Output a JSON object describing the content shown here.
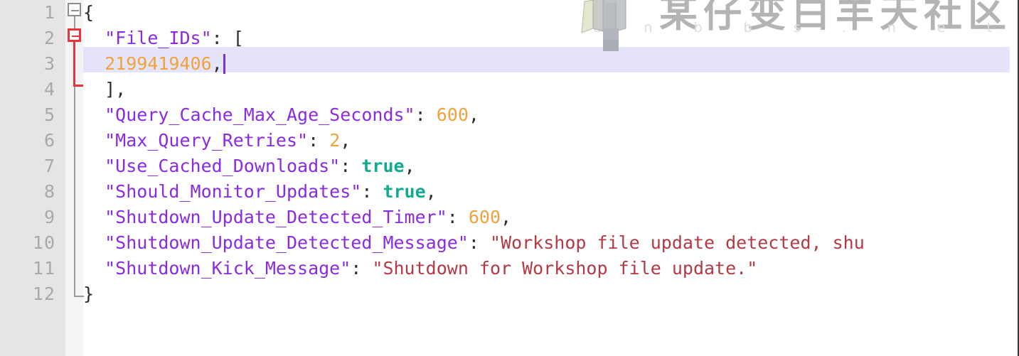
{
  "editor": {
    "language": "json",
    "active_line": 3,
    "total_lines": 12,
    "colors": {
      "background": "#ffffff",
      "gutter_background": "#e5e5e5",
      "fold_column_background": "#f4f4f4",
      "line_number": "#a9a9a9",
      "active_line_highlight": "#e6e4fa",
      "caret": "#7a34d0",
      "key": "#8a2be2",
      "number": "#f0a33c",
      "boolean": "#12ab91",
      "string": "#b33a45",
      "punctuation": "#2b2b2b",
      "fold_marker_gray": "#8d8d8d",
      "fold_marker_red": "#e8343c"
    }
  },
  "line_numbers": [
    "1",
    "2",
    "3",
    "4",
    "5",
    "6",
    "7",
    "8",
    "9",
    "10",
    "11",
    "12"
  ],
  "fold_markers": [
    {
      "line": 1,
      "state": "expanded",
      "glyph": "minus",
      "color": "gray"
    },
    {
      "line": 2,
      "state": "expanded",
      "glyph": "minus",
      "color": "red"
    }
  ],
  "lines": [
    {
      "n": 1,
      "text": "{",
      "tokens": [
        {
          "t": "{",
          "c": "p"
        }
      ]
    },
    {
      "n": 2,
      "text": "  \"File_IDs\": [",
      "tokens": [
        {
          "t": "  ",
          "c": "p"
        },
        {
          "t": "\"File_IDs\"",
          "c": "k"
        },
        {
          "t": ": [",
          "c": "p"
        }
      ]
    },
    {
      "n": 3,
      "text": "  2199419406,",
      "active": true,
      "tokens": [
        {
          "t": "  ",
          "c": "p"
        },
        {
          "t": "2199419406",
          "c": "num"
        },
        {
          "t": ",",
          "c": "p"
        }
      ]
    },
    {
      "n": 4,
      "text": "  ],",
      "tokens": [
        {
          "t": "  ],",
          "c": "p"
        }
      ]
    },
    {
      "n": 5,
      "text": "  \"Query_Cache_Max_Age_Seconds\": 600,",
      "tokens": [
        {
          "t": "  ",
          "c": "p"
        },
        {
          "t": "\"Query_Cache_Max_Age_Seconds\"",
          "c": "k"
        },
        {
          "t": ": ",
          "c": "p"
        },
        {
          "t": "600",
          "c": "num"
        },
        {
          "t": ",",
          "c": "p"
        }
      ]
    },
    {
      "n": 6,
      "text": "  \"Max_Query_Retries\": 2,",
      "tokens": [
        {
          "t": "  ",
          "c": "p"
        },
        {
          "t": "\"Max_Query_Retries\"",
          "c": "k"
        },
        {
          "t": ": ",
          "c": "p"
        },
        {
          "t": "2",
          "c": "num"
        },
        {
          "t": ",",
          "c": "p"
        }
      ]
    },
    {
      "n": 7,
      "text": "  \"Use_Cached_Downloads\": true,",
      "tokens": [
        {
          "t": "  ",
          "c": "p"
        },
        {
          "t": "\"Use_Cached_Downloads\"",
          "c": "k"
        },
        {
          "t": ": ",
          "c": "p"
        },
        {
          "t": "true",
          "c": "bool"
        },
        {
          "t": ",",
          "c": "p"
        }
      ]
    },
    {
      "n": 8,
      "text": "  \"Should_Monitor_Updates\": true,",
      "tokens": [
        {
          "t": "  ",
          "c": "p"
        },
        {
          "t": "\"Should_Monitor_Updates\"",
          "c": "k"
        },
        {
          "t": ": ",
          "c": "p"
        },
        {
          "t": "true",
          "c": "bool"
        },
        {
          "t": ",",
          "c": "p"
        }
      ]
    },
    {
      "n": 9,
      "text": "  \"Shutdown_Update_Detected_Timer\": 600,",
      "tokens": [
        {
          "t": "  ",
          "c": "p"
        },
        {
          "t": "\"Shutdown_Update_Detected_Timer\"",
          "c": "k"
        },
        {
          "t": ": ",
          "c": "p"
        },
        {
          "t": "600",
          "c": "num"
        },
        {
          "t": ",",
          "c": "p"
        }
      ]
    },
    {
      "n": 10,
      "text": "  \"Shutdown_Update_Detected_Message\": \"Workshop file update detected, shu",
      "clipped": true,
      "tokens": [
        {
          "t": "  ",
          "c": "p"
        },
        {
          "t": "\"Shutdown_Update_Detected_Message\"",
          "c": "k"
        },
        {
          "t": ": ",
          "c": "p"
        },
        {
          "t": "\"Workshop file update detected, shu",
          "c": "str"
        }
      ]
    },
    {
      "n": 11,
      "text": "  \"Shutdown_Kick_Message\": \"Shutdown for Workshop file update.\"",
      "tokens": [
        {
          "t": "  ",
          "c": "p"
        },
        {
          "t": "\"Shutdown_Kick_Message\"",
          "c": "k"
        },
        {
          "t": ": ",
          "c": "p"
        },
        {
          "t": "\"Shutdown for Workshop file update.\"",
          "c": "str"
        }
      ]
    },
    {
      "n": 12,
      "text": "}",
      "tokens": [
        {
          "t": "}",
          "c": "p"
        }
      ]
    }
  ],
  "watermark": {
    "chinese_text": "某仔变白羊天社区",
    "latin_text": "Unbbs.net",
    "latin_spaced": "U n b b s . n e t",
    "avatar": "character-avatar"
  }
}
